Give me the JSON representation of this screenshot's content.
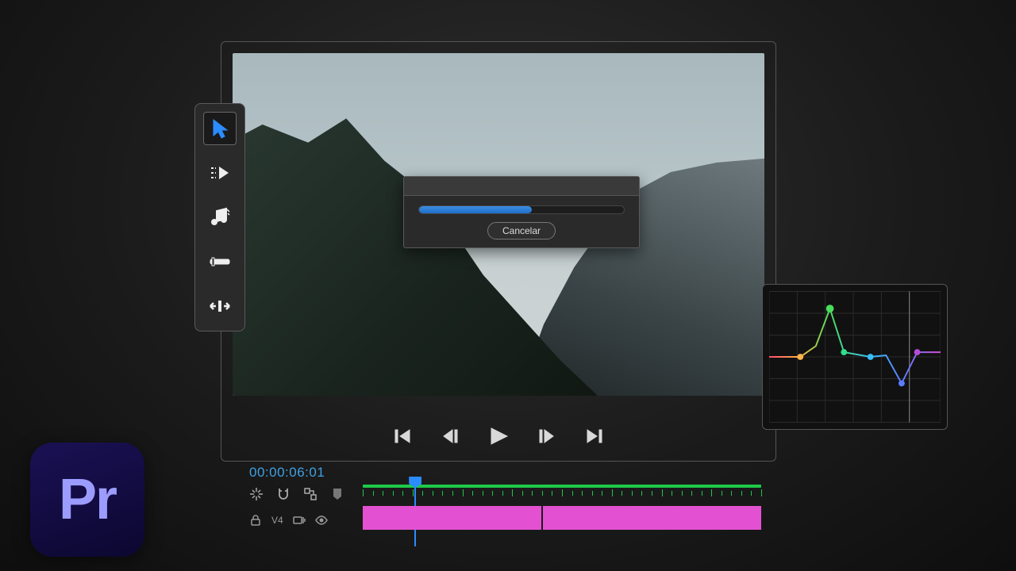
{
  "app": {
    "icon_label": "Pr"
  },
  "dialog": {
    "cancel_label": "Cancelar",
    "progress_percent": 55
  },
  "timeline": {
    "timecode": "00:00:06:01",
    "track_label": "V4",
    "playhead_percent": 13,
    "clip_color": "#e351d2",
    "ruler_color": "#1ec94a"
  },
  "tools": {
    "selected": "selection",
    "items": [
      "selection",
      "track-select",
      "music",
      "razor",
      "ripple-edit"
    ]
  },
  "transport": {
    "buttons": [
      "go-to-in",
      "step-back",
      "play",
      "step-forward",
      "go-to-out"
    ]
  },
  "scopes": {
    "type": "color-curves"
  }
}
